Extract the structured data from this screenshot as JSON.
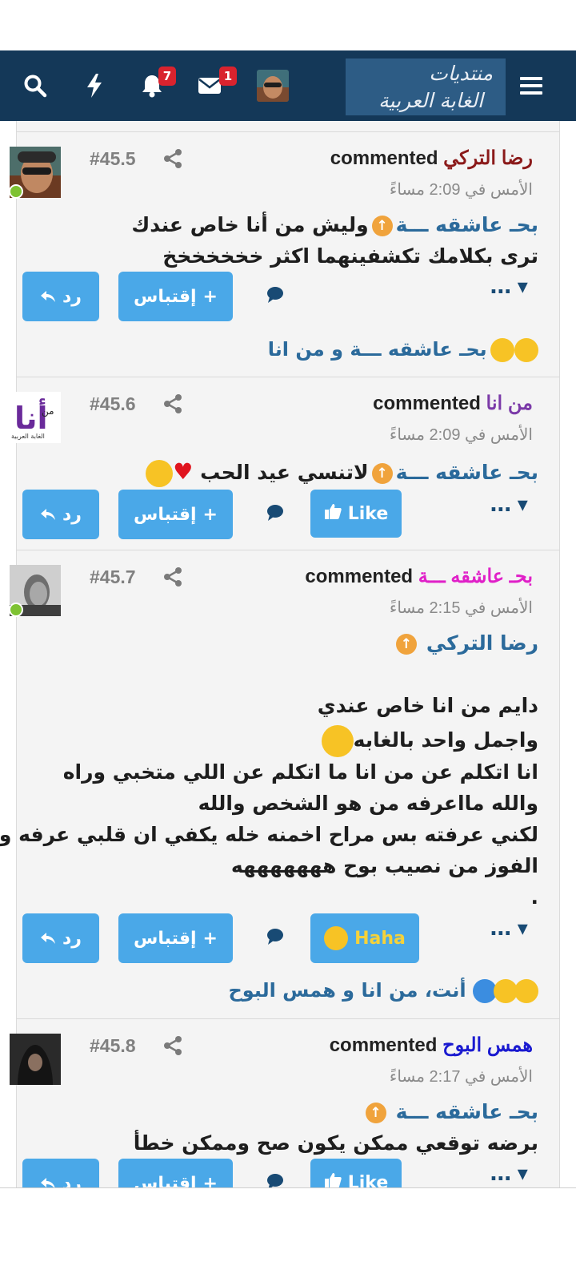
{
  "header": {
    "logo_line1": "منتديات",
    "logo_line2": "الغابة العربية",
    "messages_badge": "1",
    "notifications_badge": "7"
  },
  "colors": {
    "header_bg": "#143858",
    "button_blue": "#4aa8e8",
    "badge_red": "#d9232e",
    "online_green": "#7ec232"
  },
  "labels": {
    "commented": "commented",
    "reply": "رد",
    "quote": "إقتباس",
    "like": "Like",
    "haha": "Haha",
    "more": "..."
  },
  "posts": [
    {
      "number": "#45.5",
      "author": "رضا التركي",
      "author_color": "#8b1a1a",
      "date": "الأمس في 2:09 مساءً",
      "mention": "بحـ عاشقه ـــة",
      "lines": [
        "وليش من أنا خاص عندك",
        "ترى بكلامك تكشفينهما اكثر خخخخخخخ"
      ],
      "reactions": "بحـ عاشقه ـــة و من انا"
    },
    {
      "number": "#45.6",
      "author": "من انا",
      "author_color": "#7b3aa8",
      "date": "الأمس في 2:09 مساءً",
      "mention": "بحـ عاشقه ـــة",
      "lines": [
        "لاتنسي عيد الحب"
      ],
      "reaction_button": "Like"
    },
    {
      "number": "#45.7",
      "author": "بحـ عاشقه ـــة",
      "author_color": "#e020c8",
      "date": "الأمس في 2:15 مساءً",
      "mention": "رضا التركي",
      "lines": [
        "دايم من انا خاص عندي",
        "واجمل واحد بالغابه",
        "انا اتكلم عن من انا ما اتكلم عن اللي متخبي وراه",
        "والله مااعرفه من هو الشخص والله",
        "لكني عرفته بس مراح اخمنه خله يكفي ان قلبي عرفه والا",
        "الفوز من نصيب بوح هههههههه",
        "."
      ],
      "reaction_button": "Haha",
      "reactions": "أنت، من انا و همس البوح"
    },
    {
      "number": "#45.8",
      "author": "همس البوح",
      "author_color": "#1a1ad0",
      "date": "الأمس في 2:17 مساءً",
      "mention": "بحـ عاشقه ـــة",
      "lines": [
        "برضه توقعي ممكن يكون صح وممكن خطأ"
      ],
      "reaction_button": "Like"
    }
  ]
}
